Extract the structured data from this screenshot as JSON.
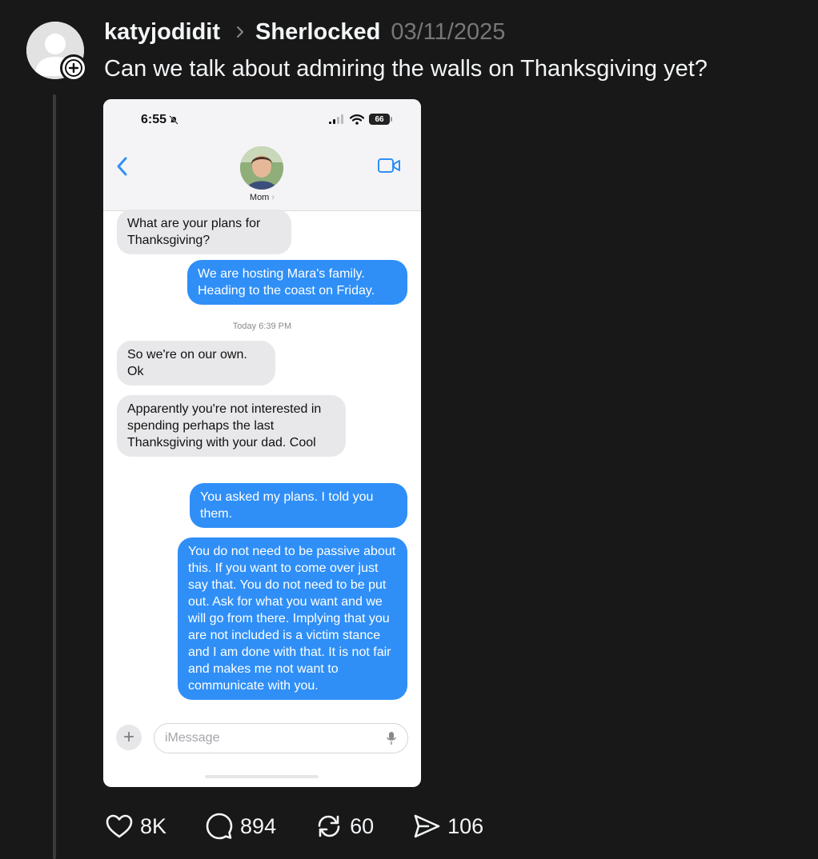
{
  "post": {
    "username": "katyjodidit",
    "community": "Sherlocked",
    "date": "03/11/2025",
    "text": "Can we talk about admiring the walls on Thanksgiving yet?"
  },
  "screenshot": {
    "status_time": "6:55",
    "battery": "66",
    "contact_name": "Mom",
    "messages": [
      {
        "from": "them",
        "text": "What are your plans for Thanksgiving?"
      },
      {
        "from": "me",
        "text": "We are hosting Mara's family. Heading to the coast on Friday."
      },
      {
        "from": "them",
        "text": "So we're on our own. Ok"
      },
      {
        "from": "them",
        "text": "Apparently you're not interested in spending perhaps the last Thanksgiving with your dad. Cool"
      },
      {
        "from": "me",
        "text": "You asked my plans. I told you them."
      },
      {
        "from": "me",
        "text": "You do not need to be passive about this. If you want to come over just say that. You do not need to be put out. Ask for what you want and we will go from there. Implying that you are not included is a victim stance and I am done with that. It is not fair and makes me not want to communicate with you."
      }
    ],
    "timestamp_label": "Today",
    "timestamp_time": "6:39 PM",
    "input_placeholder": "iMessage"
  },
  "actions": {
    "likes": "8K",
    "replies": "894",
    "reposts": "60",
    "shares": "106"
  }
}
